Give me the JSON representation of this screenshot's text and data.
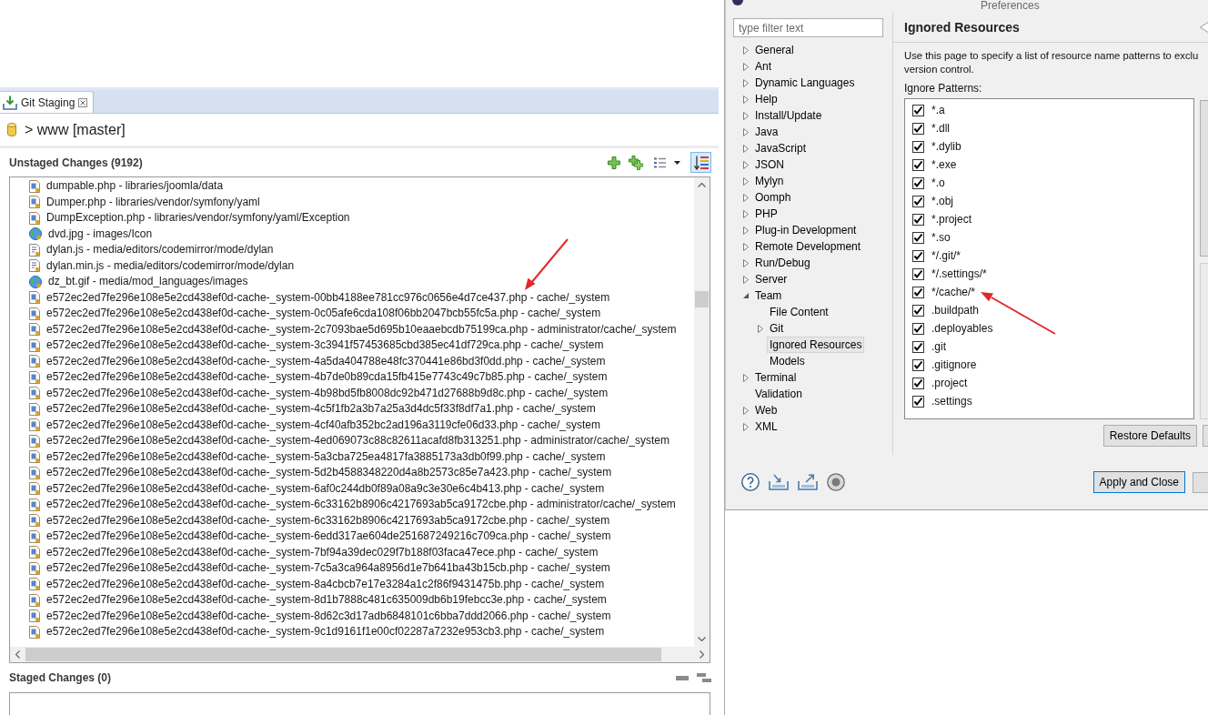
{
  "git_staging": {
    "tabs": [
      {
        "label": "Git Staging",
        "selected": true
      }
    ],
    "repository": "> www [master]",
    "unstaged": {
      "title": "Unstaged Changes (9192)",
      "sort_pressed": true,
      "files": [
        {
          "kind": "php",
          "label": "dumpable.php - libraries/joomla/data"
        },
        {
          "kind": "php",
          "label": "Dumper.php - libraries/vendor/symfony/yaml"
        },
        {
          "kind": "php",
          "label": "DumpException.php - libraries/vendor/symfony/yaml/Exception"
        },
        {
          "kind": "image",
          "label": "dvd.jpg - images/Icon"
        },
        {
          "kind": "js",
          "label": "dylan.js - media/editors/codemirror/mode/dylan"
        },
        {
          "kind": "js",
          "label": "dylan.min.js - media/editors/codemirror/mode/dylan"
        },
        {
          "kind": "image",
          "label": "dz_bt.gif - media/mod_languages/images"
        },
        {
          "kind": "php",
          "label": "e572ec2ed7fe296e108e5e2cd438ef0d-cache-_system-00bb4188ee781cc976c0656e4d7ce437.php - cache/_system"
        },
        {
          "kind": "php",
          "label": "e572ec2ed7fe296e108e5e2cd438ef0d-cache-_system-0c05afe6cda108f06bb2047bcb55fc5a.php - cache/_system"
        },
        {
          "kind": "php",
          "label": "e572ec2ed7fe296e108e5e2cd438ef0d-cache-_system-2c7093bae5d695b10eaaebcdb75199ca.php - administrator/cache/_system"
        },
        {
          "kind": "php",
          "label": "e572ec2ed7fe296e108e5e2cd438ef0d-cache-_system-3c3941f57453685cbd385ec41df729ca.php - cache/_system"
        },
        {
          "kind": "php",
          "label": "e572ec2ed7fe296e108e5e2cd438ef0d-cache-_system-4a5da404788e48fc370441e86bd3f0dd.php - cache/_system"
        },
        {
          "kind": "php",
          "label": "e572ec2ed7fe296e108e5e2cd438ef0d-cache-_system-4b7de0b89cda15fb415e7743c49c7b85.php - cache/_system"
        },
        {
          "kind": "php",
          "label": "e572ec2ed7fe296e108e5e2cd438ef0d-cache-_system-4b98bd5fb8008dc92b471d27688b9d8c.php - cache/_system"
        },
        {
          "kind": "php",
          "label": "e572ec2ed7fe296e108e5e2cd438ef0d-cache-_system-4c5f1fb2a3b7a25a3d4dc5f33f8df7a1.php - cache/_system"
        },
        {
          "kind": "php",
          "label": "e572ec2ed7fe296e108e5e2cd438ef0d-cache-_system-4cf40afb352bc2ad196a3119cfe06d33.php - cache/_system"
        },
        {
          "kind": "php",
          "label": "e572ec2ed7fe296e108e5e2cd438ef0d-cache-_system-4ed069073c88c82611acafd8fb313251.php - administrator/cache/_system"
        },
        {
          "kind": "php",
          "label": "e572ec2ed7fe296e108e5e2cd438ef0d-cache-_system-5a3cba725ea4817fa3885173a3db0f99.php - cache/_system"
        },
        {
          "kind": "php",
          "label": "e572ec2ed7fe296e108e5e2cd438ef0d-cache-_system-5d2b4588348220d4a8b2573c85e7a423.php - cache/_system"
        },
        {
          "kind": "php",
          "label": "e572ec2ed7fe296e108e5e2cd438ef0d-cache-_system-6af0c244db0f89a08a9c3e30e6c4b413.php - cache/_system"
        },
        {
          "kind": "php",
          "label": "e572ec2ed7fe296e108e5e2cd438ef0d-cache-_system-6c33162b8906c4217693ab5ca9172cbe.php - administrator/cache/_system"
        },
        {
          "kind": "php",
          "label": "e572ec2ed7fe296e108e5e2cd438ef0d-cache-_system-6c33162b8906c4217693ab5ca9172cbe.php - cache/_system"
        },
        {
          "kind": "php",
          "label": "e572ec2ed7fe296e108e5e2cd438ef0d-cache-_system-6edd317ae604de251687249216c709ca.php - cache/_system"
        },
        {
          "kind": "php",
          "label": "e572ec2ed7fe296e108e5e2cd438ef0d-cache-_system-7bf94a39dec029f7b188f03faca47ece.php - cache/_system"
        },
        {
          "kind": "php",
          "label": "e572ec2ed7fe296e108e5e2cd438ef0d-cache-_system-7c5a3ca964a8956d1e7b641ba43b15cb.php - cache/_system"
        },
        {
          "kind": "php",
          "label": "e572ec2ed7fe296e108e5e2cd438ef0d-cache-_system-8a4cbcb7e17e3284a1c2f86f9431475b.php - cache/_system"
        },
        {
          "kind": "php",
          "label": "e572ec2ed7fe296e108e5e2cd438ef0d-cache-_system-8d1b7888c481c635009db6b19febcc3e.php - cache/_system"
        },
        {
          "kind": "php",
          "label": "e572ec2ed7fe296e108e5e2cd438ef0d-cache-_system-8d62c3d17adb6848101c6bba7ddd2066.php - cache/_system"
        },
        {
          "kind": "php",
          "label": "e572ec2ed7fe296e108e5e2cd438ef0d-cache-_system-9c1d9161f1e00cf02287a7232e953cb3.php - cache/_system"
        }
      ]
    },
    "staged": {
      "title": "Staged Changes (0)"
    }
  },
  "preferences": {
    "title": "Preferences",
    "filter": {
      "placeholder": "type filter text"
    },
    "tree": [
      {
        "label": "General",
        "expanded": false,
        "selected": false
      },
      {
        "label": "Ant",
        "expanded": false,
        "selected": false
      },
      {
        "label": "Dynamic Languages",
        "expanded": false,
        "selected": false
      },
      {
        "label": "Help",
        "expanded": false,
        "selected": false
      },
      {
        "label": "Install/Update",
        "expanded": false,
        "selected": false
      },
      {
        "label": "Java",
        "expanded": false,
        "selected": false
      },
      {
        "label": "JavaScript",
        "expanded": false,
        "selected": false
      },
      {
        "label": "JSON",
        "expanded": false,
        "selected": false
      },
      {
        "label": "Mylyn",
        "expanded": false,
        "selected": false
      },
      {
        "label": "Oomph",
        "expanded": false,
        "selected": false
      },
      {
        "label": "PHP",
        "expanded": false,
        "selected": false
      },
      {
        "label": "Plug-in Development",
        "expanded": false,
        "selected": false
      },
      {
        "label": "Remote Development",
        "expanded": false,
        "selected": false
      },
      {
        "label": "Run/Debug",
        "expanded": false,
        "selected": false
      },
      {
        "label": "Server",
        "expanded": false,
        "selected": false
      },
      {
        "label": "Team",
        "expanded": true,
        "selected": false,
        "children": [
          {
            "label": "File Content",
            "selected": false
          },
          {
            "label": "Git",
            "expanded": false,
            "selected": false
          },
          {
            "label": "Ignored Resources",
            "selected": true
          },
          {
            "label": "Models",
            "selected": false
          }
        ]
      },
      {
        "label": "Terminal",
        "expanded": false,
        "selected": false
      },
      {
        "label": "Validation",
        "selected": false
      },
      {
        "label": "Web",
        "expanded": false,
        "selected": false
      },
      {
        "label": "XML",
        "expanded": false,
        "selected": false
      }
    ],
    "page": {
      "title": "Ignored Resources",
      "description_lines": [
        "Use this page to specify a list of resource name patterns to exclu",
        "version control."
      ],
      "patterns_label": "Ignore Patterns:",
      "patterns": [
        {
          "pattern": "*.a",
          "checked": true
        },
        {
          "pattern": "*.dll",
          "checked": true
        },
        {
          "pattern": "*.dylib",
          "checked": true
        },
        {
          "pattern": "*.exe",
          "checked": true
        },
        {
          "pattern": "*.o",
          "checked": true
        },
        {
          "pattern": "*.obj",
          "checked": true
        },
        {
          "pattern": "*.project",
          "checked": true
        },
        {
          "pattern": "*.so",
          "checked": true
        },
        {
          "pattern": "*/.git/*",
          "checked": true
        },
        {
          "pattern": "*/.settings/*",
          "checked": true
        },
        {
          "pattern": "*/cache/*",
          "checked": true
        },
        {
          "pattern": ".buildpath",
          "checked": true
        },
        {
          "pattern": ".deployables",
          "checked": true
        },
        {
          "pattern": ".git",
          "checked": true
        },
        {
          "pattern": ".gitignore",
          "checked": true
        },
        {
          "pattern": ".project",
          "checked": true
        },
        {
          "pattern": ".settings",
          "checked": true
        }
      ],
      "restore_button": "Restore Defaults"
    },
    "apply_button": "Apply and Close"
  }
}
